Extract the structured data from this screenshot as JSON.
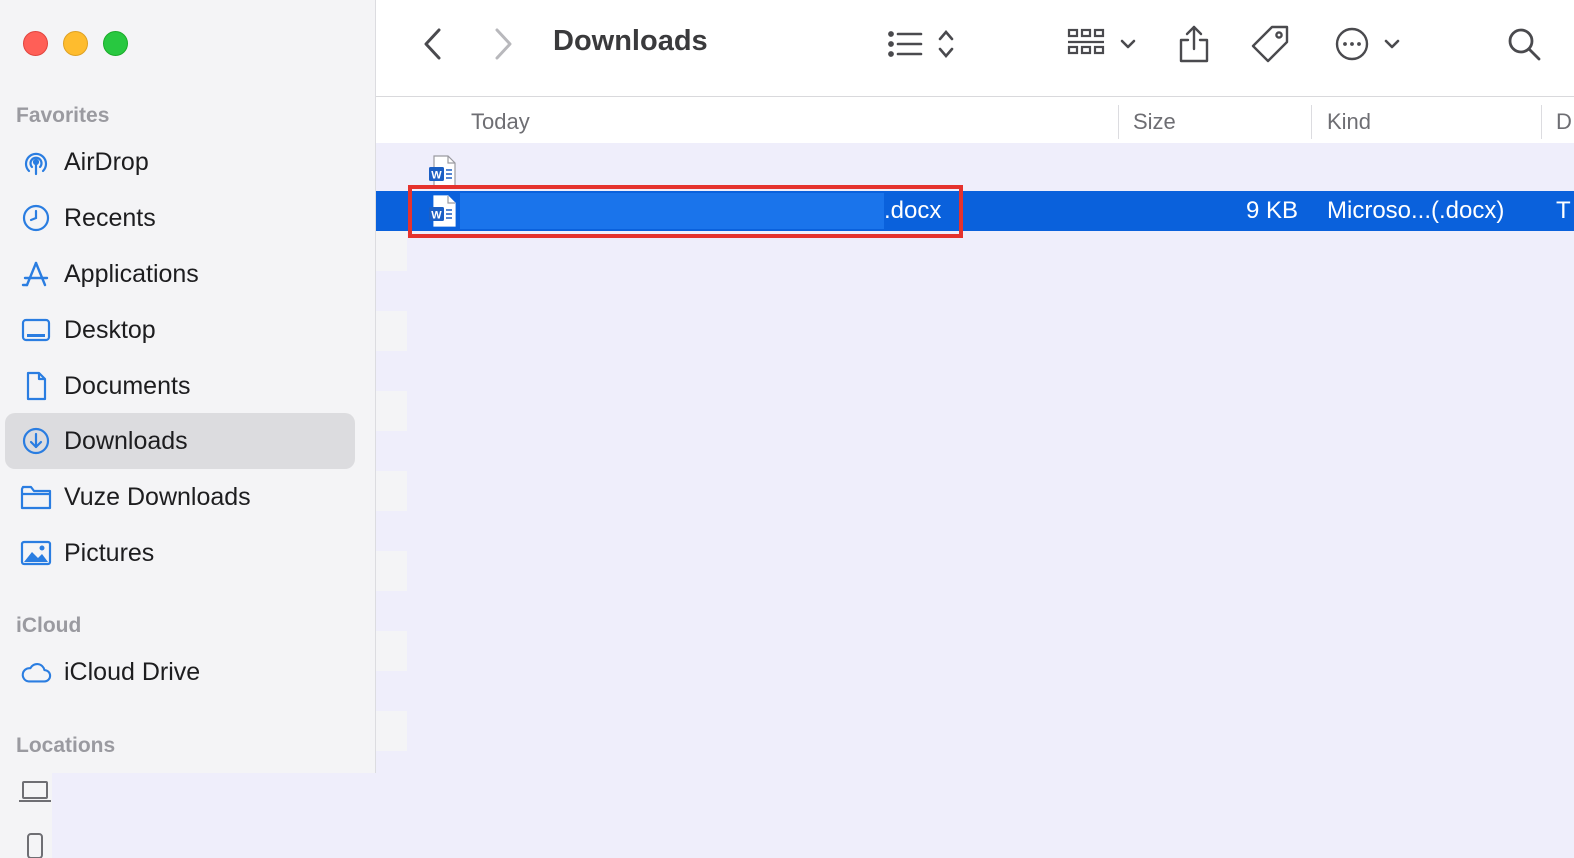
{
  "window": {
    "title": "Downloads"
  },
  "sidebar": {
    "favorites_title": "Favorites",
    "items": [
      {
        "label": "AirDrop",
        "icon": "airdrop-icon"
      },
      {
        "label": "Recents",
        "icon": "clock-icon"
      },
      {
        "label": "Applications",
        "icon": "applications-icon"
      },
      {
        "label": "Desktop",
        "icon": "desktop-icon"
      },
      {
        "label": "Documents",
        "icon": "document-icon"
      },
      {
        "label": "Downloads",
        "icon": "download-icon",
        "selected": true
      },
      {
        "label": "Vuze Downloads",
        "icon": "folder-icon"
      },
      {
        "label": "Pictures",
        "icon": "photo-icon"
      }
    ],
    "icloud_title": "iCloud",
    "icloud_items": [
      {
        "label": "iCloud Drive",
        "icon": "cloud-icon"
      }
    ],
    "locations_title": "Locations"
  },
  "columns": {
    "name": "Today",
    "size": "Size",
    "kind": "Kind",
    "date": "D"
  },
  "files": [
    {
      "name": "",
      "size": "",
      "kind": "",
      "date": ""
    },
    {
      "name": ".docx",
      "size": "9 KB",
      "kind": "Microso...(.docx)",
      "date": "T",
      "selected": true
    }
  ],
  "colors": {
    "accent": "#0a61dc",
    "highlight": "#e5322d",
    "sidebar_icon": "#2a7de1"
  }
}
